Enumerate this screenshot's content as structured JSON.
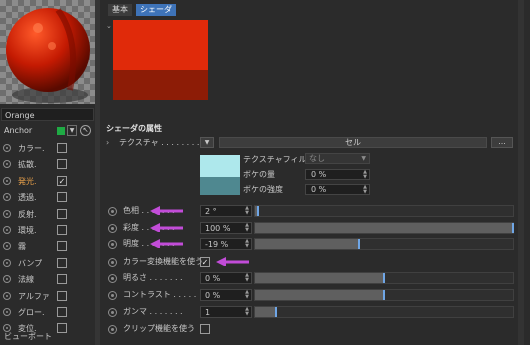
{
  "material": {
    "name": "Orange"
  },
  "anchor": {
    "label": "Anchor",
    "swatch_color": "#1faa44"
  },
  "channels": [
    {
      "label": "カラー.",
      "checked": false,
      "highlight": false
    },
    {
      "label": "拡散.",
      "checked": false,
      "highlight": false
    },
    {
      "label": "発光.",
      "checked": true,
      "highlight": true
    },
    {
      "label": "透過.",
      "checked": false,
      "highlight": false
    },
    {
      "label": "反射.",
      "checked": false,
      "highlight": false
    },
    {
      "label": "環境.",
      "checked": false,
      "highlight": false
    },
    {
      "label": "霧",
      "checked": false,
      "highlight": false
    },
    {
      "label": "バンプ",
      "checked": false,
      "highlight": false
    },
    {
      "label": "法線",
      "checked": false,
      "highlight": false
    },
    {
      "label": "アルファ",
      "checked": false,
      "highlight": false
    },
    {
      "label": "グロー.",
      "checked": false,
      "highlight": false
    },
    {
      "label": "変位.",
      "checked": false,
      "highlight": false
    }
  ],
  "viewport_label": "ビューポート",
  "tabs": [
    "基本",
    "シェーダ"
  ],
  "active_tab": "シェーダ",
  "swatch_colors": {
    "top": "#e02a0a",
    "bottom": "#8d1c06"
  },
  "shader": {
    "section_title": "シェーダの属性",
    "texture_label": "テクスチャ . . . . . . . . .",
    "texture_value": "セル",
    "texture_btn": "...",
    "filter_label": "テクスチャフィルタ",
    "filter_value": "なし",
    "blur_offset_label": "ボケの量",
    "blur_offset_value": "0 %",
    "blur_scale_label": "ボケの強度",
    "blur_scale_value": "0 %"
  },
  "params": [
    {
      "label": "色相 . . . . . . .",
      "value": "2 °",
      "slider": 0.01,
      "arrow": true
    },
    {
      "label": "彩度 . . . . . . .",
      "value": "100 %",
      "slider": 1.0,
      "arrow": true
    },
    {
      "label": "明度 . . . . . . .",
      "value": "-19 %",
      "slider": 0.405,
      "arrow": true
    },
    {
      "label": "カラー変換機能を使う",
      "checkbox": true,
      "checked": true,
      "arrow": true
    },
    {
      "label": "明るさ . . . . . . .",
      "value": "0 %",
      "slider": 0.5,
      "arrow": false
    },
    {
      "label": "コントラスト . . . . .",
      "value": "0 %",
      "slider": 0.5,
      "arrow": false
    },
    {
      "label": "ガンマ . . . . . . .",
      "value": "1",
      "slider": 0.08,
      "arrow": false
    },
    {
      "label": "クリップ機能を使う",
      "checkbox": true,
      "checked": false,
      "arrow": false
    }
  ],
  "annotation_color": "#c24cd8"
}
